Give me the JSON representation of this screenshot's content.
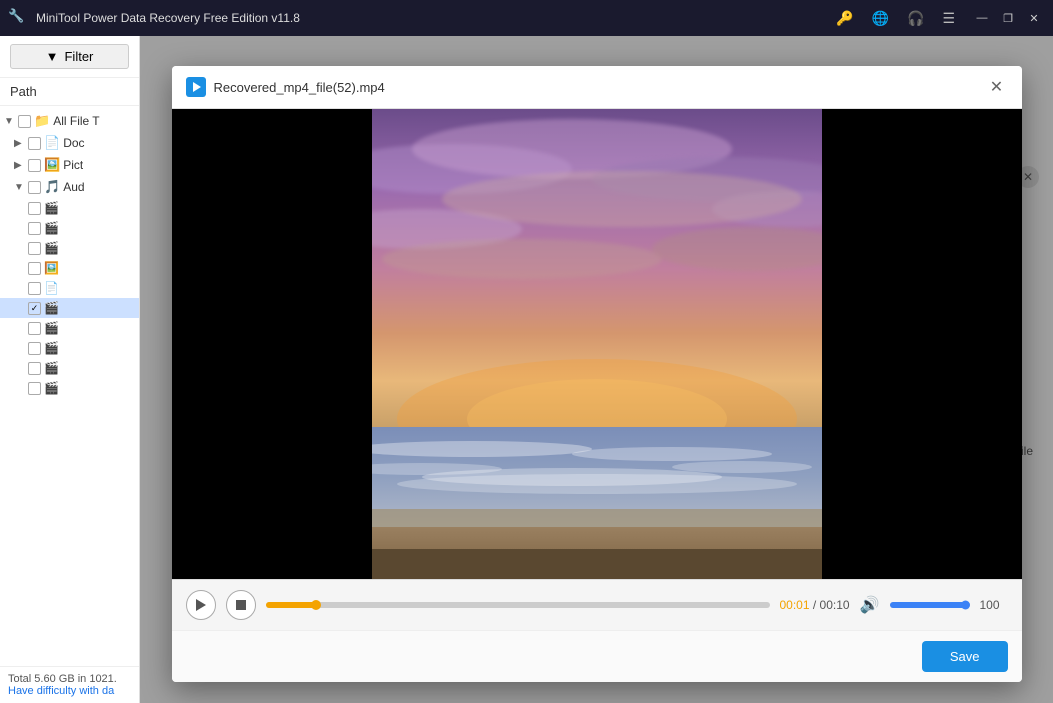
{
  "app": {
    "title": "MiniTool Power Data Recovery Free Edition v11.8",
    "logo_char": "🔧"
  },
  "titlebar": {
    "icons": [
      "🔑",
      "🌐",
      "🎧",
      "☰"
    ],
    "minimize": "—",
    "maximize": "❐",
    "close": "✕"
  },
  "sidebar": {
    "filter_label": "Filter",
    "path_label": "Path",
    "tree": [
      {
        "id": "all-files",
        "label": "All File T",
        "level": 0,
        "expanded": true,
        "icon": "folder-yellow"
      },
      {
        "id": "doc",
        "label": "Doc",
        "level": 1,
        "expanded": false,
        "icon": "folder-blue"
      },
      {
        "id": "pictures",
        "label": "Pict",
        "level": 1,
        "expanded": false,
        "icon": "folder-picture"
      },
      {
        "id": "audio",
        "label": "Aud",
        "level": 1,
        "expanded": true,
        "icon": "folder-audio"
      },
      {
        "id": "item1",
        "label": "",
        "level": 2,
        "icon": "file-video"
      },
      {
        "id": "item2",
        "label": "",
        "level": 2,
        "icon": "file-video"
      },
      {
        "id": "item3",
        "label": "",
        "level": 2,
        "icon": "file-video"
      },
      {
        "id": "item4",
        "label": "",
        "level": 2,
        "icon": "file-img"
      },
      {
        "id": "item5",
        "label": "",
        "level": 2,
        "icon": "file-generic"
      },
      {
        "id": "item6",
        "label": "",
        "level": 2,
        "icon": "file-video",
        "selected": true
      },
      {
        "id": "item7",
        "label": "",
        "level": 2,
        "icon": "file-video"
      },
      {
        "id": "item8",
        "label": "",
        "level": 2,
        "icon": "file-video"
      },
      {
        "id": "item9",
        "label": "",
        "level": 2,
        "icon": "file-video"
      },
      {
        "id": "item10",
        "label": "",
        "level": 2,
        "icon": "file-video"
      }
    ],
    "bottom_text": "Total 5.60 GB in 1021.",
    "help_link": "Have difficulty with da"
  },
  "dialog": {
    "title": "Recovered_mp4_file(52).mp4",
    "close_btn": "✕",
    "video": {
      "current_time": "00:01",
      "total_time": "00:10",
      "progress_percent": 10,
      "volume": 100,
      "volume_percent": 95
    },
    "save_btn": "Save"
  },
  "bg": {
    "close_x": "✕",
    "filename_hint": "_file"
  }
}
